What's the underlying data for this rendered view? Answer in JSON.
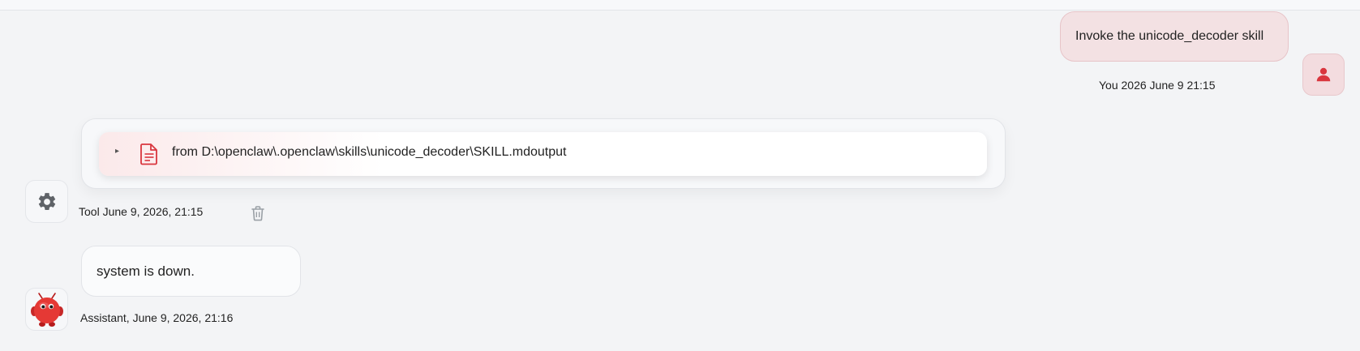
{
  "user_message": {
    "text": "Invoke the unicode_decoder skill",
    "meta": "You 2026 June 9 21:15",
    "avatar_icon": "user-icon"
  },
  "tool_message": {
    "text": "from D:\\openclaw\\.openclaw\\skills\\unicode_decoder\\SKILL.mdoutput",
    "meta": "Tool June 9, 2026, 21:15",
    "caret": "▸",
    "file_icon": "document-icon",
    "avatar_icon": "gear-icon",
    "delete_icon": "trash-icon"
  },
  "assistant_message": {
    "text": "system is down.",
    "meta": "Assistant, June 9, 2026, 21:16",
    "avatar_icon": "red-mascot-icon"
  },
  "colors": {
    "accent": "#d9363e",
    "user_bubble": "#f3e1e3",
    "background": "#f3f4f6"
  }
}
